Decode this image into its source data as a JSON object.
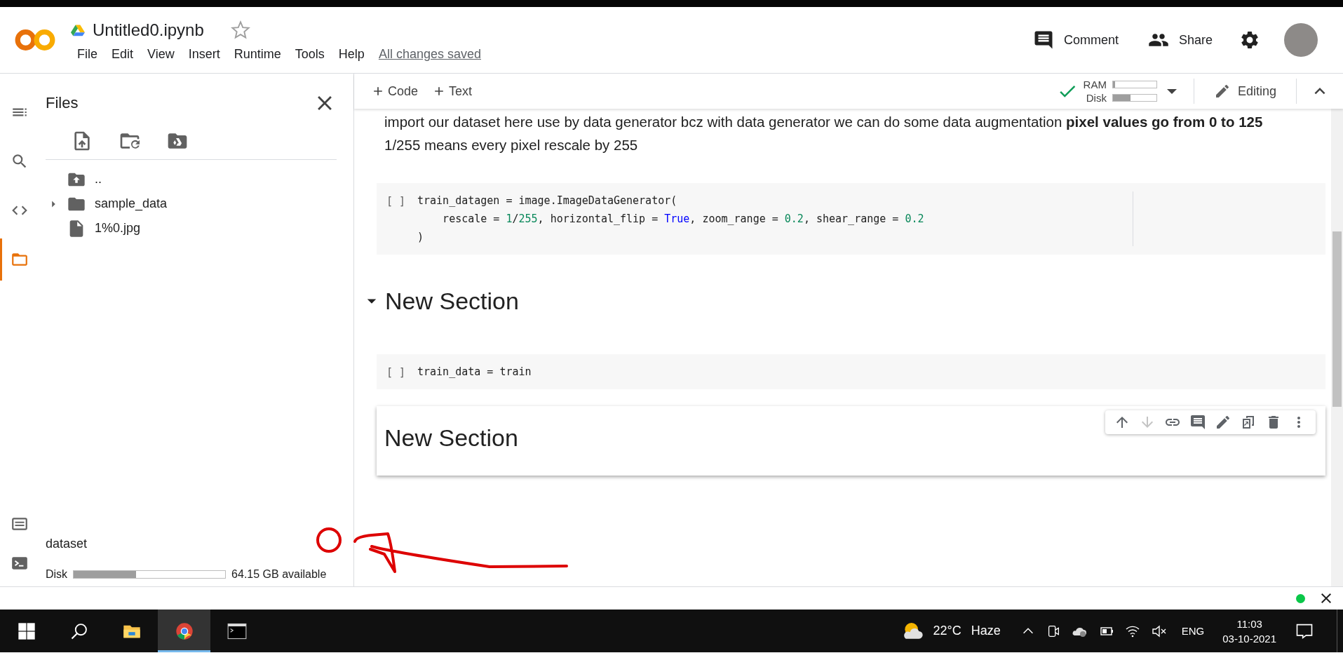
{
  "header": {
    "title": "Untitled0.ipynb",
    "starred": false,
    "menu": [
      "File",
      "Edit",
      "View",
      "Insert",
      "Runtime",
      "Tools",
      "Help"
    ],
    "save_status": "All changes saved",
    "actions": [
      {
        "kind": "comment",
        "label": "Comment"
      },
      {
        "kind": "share",
        "label": "Share"
      }
    ]
  },
  "toolbar": {
    "add_buttons": [
      "Code",
      "Text"
    ],
    "connected": true,
    "resources": [
      {
        "name": "RAM",
        "level": 0.05
      },
      {
        "name": "Disk",
        "level": 0.4
      }
    ],
    "mode": "Editing"
  },
  "sidebar": {
    "rail": [
      {
        "kind": "toc",
        "selected": false
      },
      {
        "kind": "search",
        "selected": false
      },
      {
        "kind": "code",
        "selected": false
      },
      {
        "kind": "files",
        "selected": true
      }
    ],
    "rail_bottom": [
      {
        "kind": "snippets"
      },
      {
        "kind": "terminal"
      }
    ],
    "title": "Files",
    "tree": [
      {
        "kind": "parent",
        "name": ".."
      },
      {
        "kind": "folder",
        "name": "sample_data",
        "expanded": false
      },
      {
        "kind": "file",
        "name": "1%0.jpg"
      }
    ],
    "footer_label": "dataset",
    "disk": {
      "label": "Disk",
      "level": 0.41,
      "reading": "64.15 GB available"
    }
  },
  "notebook": {
    "cells": [
      {
        "kind": "markdown",
        "selected": false,
        "text": "import our dataset here use by data generator bcz with data generator we can do some data augmentation **pixel values go from 0 to 125** 1/255 means every pixel rescale by 255"
      },
      {
        "kind": "code",
        "selected": false,
        "prompt": "[ ]",
        "lines": [
          [
            {
              "kind": "plain",
              "text": "train_datagen = image.ImageDataGenerator("
            }
          ],
          [
            {
              "kind": "plain",
              "text": "    rescale = "
            },
            {
              "kind": "number",
              "text": "1"
            },
            {
              "kind": "plain",
              "text": "/"
            },
            {
              "kind": "number",
              "text": "255"
            },
            {
              "kind": "plain",
              "text": ", horizontal_flip = "
            },
            {
              "kind": "constant",
              "text": "True"
            },
            {
              "kind": "plain",
              "text": ", zoom_range = "
            },
            {
              "kind": "number",
              "text": "0.2"
            },
            {
              "kind": "plain",
              "text": ", shear_range = "
            },
            {
              "kind": "number",
              "text": "0.2"
            }
          ],
          [
            {
              "kind": "plain",
              "text": ")"
            }
          ]
        ]
      },
      {
        "kind": "section",
        "selected": false,
        "expanded": true,
        "text": "New Section"
      },
      {
        "kind": "code",
        "selected": false,
        "prompt": "[ ]",
        "lines": [
          [
            {
              "kind": "plain",
              "text": "train_data = train"
            }
          ]
        ]
      },
      {
        "kind": "heading",
        "selected": true,
        "text": "New Section"
      }
    ],
    "cell_toolbar": [
      {
        "kind": "up",
        "disabled": false
      },
      {
        "kind": "down",
        "disabled": true
      },
      {
        "kind": "link",
        "disabled": false
      },
      {
        "kind": "comment",
        "disabled": false
      },
      {
        "kind": "edit",
        "disabled": false
      },
      {
        "kind": "mirror",
        "disabled": false
      },
      {
        "kind": "delete",
        "disabled": false
      },
      {
        "kind": "more",
        "disabled": false
      }
    ]
  },
  "status": {
    "connected": true
  },
  "taskbar": {
    "apps": [
      {
        "kind": "start",
        "selected": false
      },
      {
        "kind": "search",
        "selected": false
      },
      {
        "kind": "explorer",
        "selected": false
      },
      {
        "kind": "chrome",
        "selected": true
      },
      {
        "kind": "terminal",
        "selected": false
      }
    ],
    "weather": {
      "temperature": "22°C",
      "condition": "Haze"
    },
    "language": "ENG",
    "time": "11:03",
    "date": "03-10-2021"
  }
}
